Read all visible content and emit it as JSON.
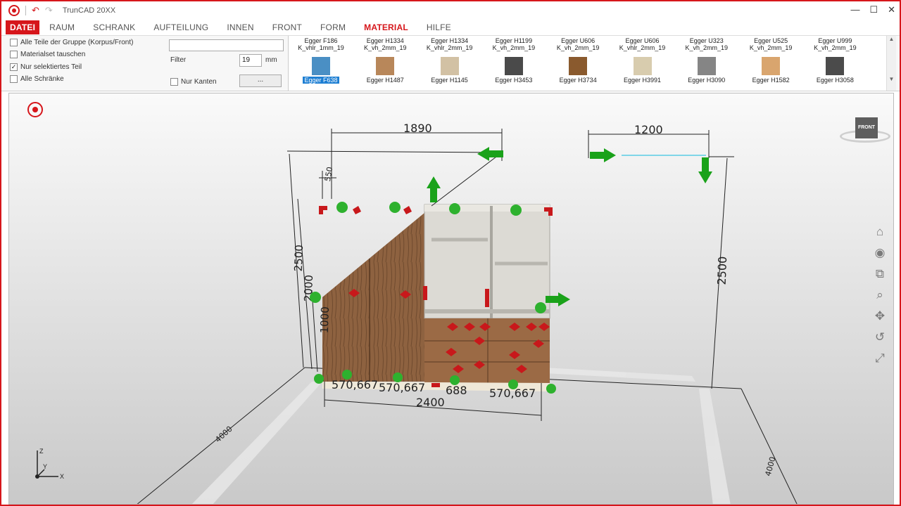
{
  "app": {
    "title": "TrunCAD 20XX"
  },
  "tabs": [
    {
      "label": "DATEI"
    },
    {
      "label": "RAUM"
    },
    {
      "label": "SCHRANK"
    },
    {
      "label": "AUFTEILUNG"
    },
    {
      "label": "INNEN"
    },
    {
      "label": "FRONT"
    },
    {
      "label": "FORM"
    },
    {
      "label": "MATERIAL"
    },
    {
      "label": "HILFE"
    }
  ],
  "ribbon": {
    "options": [
      {
        "label": "Alle Teile der Gruppe (Korpus/Front)",
        "checked": false
      },
      {
        "label": "Materialset tauschen",
        "checked": false
      },
      {
        "label": "Nur selektiertes Teil",
        "checked": true
      },
      {
        "label": "Alle Schränke",
        "checked": false
      }
    ],
    "search_value": "",
    "filter_label": "Filter",
    "filter_value": "19",
    "filter_unit": "mm",
    "nur_kanten_label": "Nur Kanten",
    "dots_button": "..."
  },
  "materials_row1": [
    {
      "name": "Egger F186",
      "desc": "K_vhlr_1mm_19"
    },
    {
      "name": "Egger H1334",
      "desc": "K_vh_2mm_19"
    },
    {
      "name": "Egger H1334",
      "desc": "K_vhlr_2mm_19"
    },
    {
      "name": "Egger H1199",
      "desc": "K_vh_2mm_19"
    },
    {
      "name": "Egger U606",
      "desc": "K_vh_2mm_19"
    },
    {
      "name": "Egger U606",
      "desc": "K_vhlr_2mm_19"
    },
    {
      "name": "Egger U323",
      "desc": "K_vh_2mm_19"
    },
    {
      "name": "Egger U525",
      "desc": "K_vh_2mm_19"
    },
    {
      "name": "Egger U999",
      "desc": "K_vh_2mm_19"
    }
  ],
  "materials_row2": [
    {
      "name": "Egger F638",
      "color": "#4a8fc4",
      "selected": true
    },
    {
      "name": "Egger H1487",
      "color": "#b8875a",
      "selected": false
    },
    {
      "name": "Egger H1145",
      "color": "#d2c1a4",
      "selected": false
    },
    {
      "name": "Egger H3453",
      "color": "#4a4a4a",
      "selected": false
    },
    {
      "name": "Egger H3734",
      "color": "#8a5a2e",
      "selected": false
    },
    {
      "name": "Egger H3991",
      "color": "#d8ccae",
      "selected": false
    },
    {
      "name": "Egger H3090",
      "color": "#858585",
      "selected": false
    },
    {
      "name": "Egger H1582",
      "color": "#d9a56e",
      "selected": false
    },
    {
      "name": "Egger H3058",
      "color": "#4b4b4b",
      "selected": false
    }
  ],
  "dimensions": {
    "top_width": "1890",
    "right_width": "1200",
    "slope_offset": "550",
    "height_total": "2500",
    "height_2000": "2000",
    "height_1000": "1000",
    "right_height": "2500",
    "seg1": "570,667",
    "seg2": "570,667",
    "seg3": "688",
    "seg4": "570,667",
    "bottom_width": "2400",
    "floor_left": "4000",
    "floor_right": "4000"
  },
  "viewcube": {
    "label": "FRONT"
  },
  "axes": {
    "x": "X",
    "y": "Y",
    "z": "Z"
  },
  "colors": {
    "accent": "#d6161b",
    "arrow": "#1aa21a",
    "handle": "#c8181b"
  }
}
